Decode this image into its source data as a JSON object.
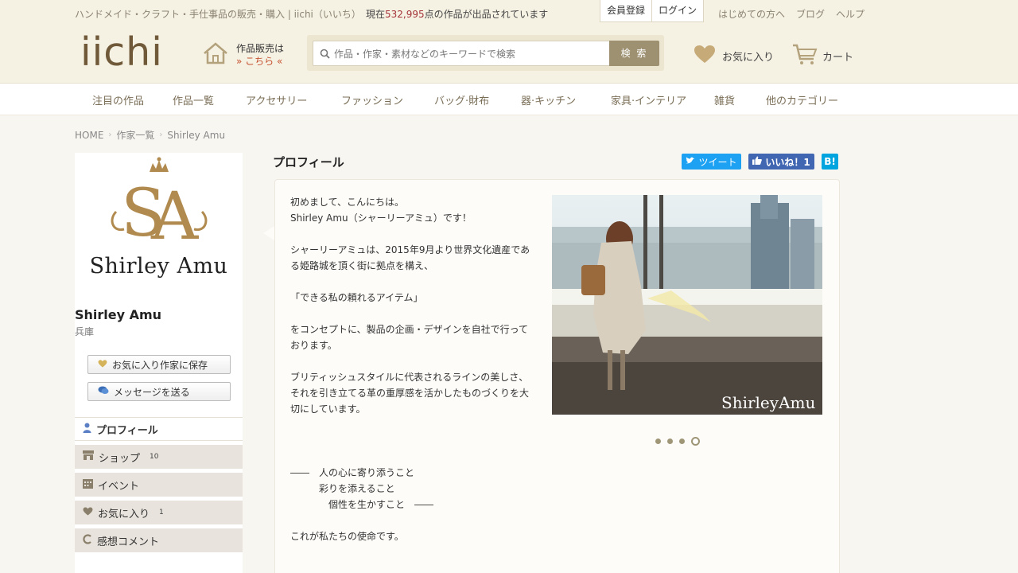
{
  "header": {
    "tagline": "ハンドメイド・クラフト・手仕事品の販売・購入 | iichi（いいち）",
    "stat_prefix": "現在",
    "stat_number": "532,995",
    "stat_suffix": "点の作品が出品されています",
    "register_label": "会員登録",
    "login_label": "ログイン",
    "toplinks": [
      "はじめての方へ",
      "ブログ",
      "ヘルプ"
    ],
    "logo": "iichi",
    "sell_line1": "作品販売は",
    "sell_line2": "» こちら «",
    "search_placeholder": "作品・作家・素材などのキーワードで検索",
    "search_button": "検 索",
    "favorites_label": "お気に入り",
    "cart_label": "カート"
  },
  "nav": [
    "注目の作品",
    "作品一覧",
    "アクセサリー",
    "ファッション",
    "バッグ·財布",
    "器·キッチン",
    "家具·インテリア",
    "雑貨",
    "他のカテゴリー"
  ],
  "breadcrumb": [
    "HOME",
    "作家一覧",
    "Shirley Amu"
  ],
  "sidebar": {
    "brand_text": "Shirley Amu",
    "name": "Shirley Amu",
    "prefecture": "兵庫",
    "save_button": "お気に入り作家に保存",
    "message_button": "メッセージを送る",
    "menu": [
      {
        "label": "プロフィール",
        "count": ""
      },
      {
        "label": "ショップ",
        "count": "10"
      },
      {
        "label": "イベント",
        "count": ""
      },
      {
        "label": "お気に入り",
        "count": "1"
      },
      {
        "label": "感想コメント",
        "count": ""
      }
    ]
  },
  "main": {
    "title": "プロフィール",
    "tweet_label": "ツイート",
    "like_label": "いいね！1",
    "hatena_label": "B!",
    "paragraphs": [
      "初めまして、こんにちは。\nShirley Amu（シャーリーアミュ）です！",
      "シャーリーアミュは、2015年9月より世界文化遺産であ\nる姫路城を頂く街に拠点を構え、",
      "「できる私の頼れるアイテム」",
      "をコンセプトに、製品の企画・デザインを自社で行って\nおります。",
      "ブリティッシュスタイルに代表されるラインの美しさ、\nそれを引き立てる革の重厚感を活かしたものづくりを大\n切にしています。",
      "――　人の心に寄り添うこと\n　　　彩りを添えること\n　　　　個性を生かすこと　――",
      "これが私たちの使命です。"
    ],
    "photo_caption": "ShirleyAmu"
  },
  "colors": {
    "header_bg": "#f5f1e3",
    "brand_gold": "#b08a4e",
    "accent_red": "#a5343a",
    "twitter": "#1da1f2",
    "facebook": "#4267b2",
    "hatena": "#00a4de"
  }
}
